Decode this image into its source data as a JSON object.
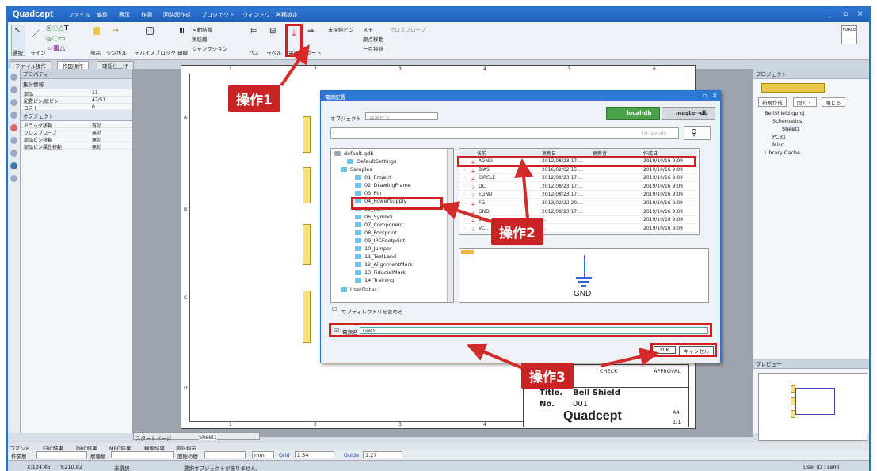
{
  "app": {
    "logo": "Quadcept",
    "menus": [
      "ファイル",
      "編集",
      "表示",
      "作図",
      "回路図作成",
      "プロジェクト",
      "ウィンドウ",
      "各種設定"
    ],
    "win_min": "_",
    "win_max": "▫",
    "win_close": "×"
  },
  "ribbon": {
    "select": "選択",
    "line": "ライン",
    "part": "部品",
    "symbol": "シンボル",
    "device_block": "デバイスブロック",
    "bus_entry": "母線",
    "auto_wire": "自動結線",
    "real_wire": "実結線",
    "junction": "ジャンクション",
    "path": "パス",
    "label": "ラベル",
    "power": "電源",
    "port": "ポート",
    "unconnected": "未接続ピン",
    "memo": "メモ",
    "cross_probe": "クロスプローブ",
    "origin_move": "原点移動",
    "one_move": "一点接続",
    "force": "FORCE"
  },
  "tabs": [
    "ファイル操作",
    "作図操作",
    "確認仕上げ"
  ],
  "props": {
    "title": "プロパティ",
    "section1": "集計情報",
    "rows1": [
      {
        "k": "部品",
        "v": "11"
      },
      {
        "k": "配置ピン/総ピン",
        "v": "47/51"
      },
      {
        "k": "コスト",
        "v": "0"
      }
    ],
    "section2": "オブジェクト",
    "rows2": [
      {
        "k": "ドラッグ移動",
        "v": "有効"
      },
      {
        "k": "クロスプローブ",
        "v": "無効"
      },
      {
        "k": "部品ピン移動",
        "v": "無効"
      },
      {
        "k": "部品ピン属性移動",
        "v": "無効"
      }
    ]
  },
  "sheet": {
    "cols": [
      "1",
      "2",
      "3",
      "4",
      "5",
      "6"
    ],
    "rows": [
      "A",
      "B",
      "C",
      "D"
    ],
    "titleblock": {
      "check": "CHECK",
      "approval": "APPROVAL",
      "title_label": "Title.",
      "title": "Bell Shield",
      "no_label": "No.",
      "no": "001",
      "brand": "Quadcept",
      "size": "A4",
      "page": "1/1"
    }
  },
  "dialog": {
    "title": "電源配置",
    "object_label": "オブジェクト",
    "object_value": "電源ピン",
    "local_db": "local-db",
    "master_db": "master-db",
    "results": "10 results",
    "tree": [
      "default.qdb",
      "DefaultSettings",
      "Samples",
      "01_Project",
      "02_DrawingFrame",
      "03_Pin",
      "04_PowerSupply",
      "05_Port",
      "06_Symbol",
      "07_Component",
      "08_Footprint",
      "09_IPCFootprint",
      "10_Jumper",
      "11_TestLand",
      "12_AlignmentMark",
      "13_FiducialMark",
      "14_Training",
      "UserDatas"
    ],
    "subdir": "サブディレクトリを含める",
    "headers": [
      "名前",
      "更新日",
      "更新者",
      "作成日"
    ],
    "rows": [
      {
        "name": "AGND",
        "upd": "2012/08/23 17:…",
        "cr": "2019/10/16 9:09"
      },
      {
        "name": "BIAS",
        "upd": "2016/02/02 15:…",
        "cr": "2019/10/16 9:09"
      },
      {
        "name": "CIRCLE",
        "upd": "2012/08/23 17:…",
        "cr": "2019/10/16 9:09"
      },
      {
        "name": "DC",
        "upd": "2012/08/23 17:…",
        "cr": "2019/10/16 9:09"
      },
      {
        "name": "EGND",
        "upd": "2012/08/23 17:…",
        "cr": "2019/10/16 9:09"
      },
      {
        "name": "FG",
        "upd": "2013/02/22 20:…",
        "cr": "2019/10/16 9:09"
      },
      {
        "name": "GND",
        "upd": "2012/08/23 17:…",
        "cr": "2019/10/16 9:09"
      },
      {
        "name": "V…",
        "upd": "…",
        "cr": "2019/10/16 9:09"
      },
      {
        "name": "VC…",
        "upd": "…",
        "cr": "2019/10/16 9:09"
      }
    ],
    "preview_label": "GND",
    "name_label": "電源名",
    "name_value": "GND",
    "ok": "O K",
    "cancel": "キャンセル"
  },
  "callouts": {
    "op1": "操作1",
    "op2": "操作2",
    "op3": "操作3"
  },
  "project": {
    "title": "プロジェクト",
    "new_btn": "新規作成",
    "open_btn": "開く・",
    "close_btn": "閉じる",
    "tree": [
      "BellShield.qproj",
      "Schematics",
      "Sheet1",
      "PCB1",
      "Misc",
      "Library Cache"
    ],
    "preview_title": "プレビュー"
  },
  "doc_tabs": {
    "start": "スタートページ",
    "sheet": "Sheet1"
  },
  "bottom": {
    "tabs": [
      "コマンド",
      "ERC結果",
      "DRC結果",
      "MRC結果",
      "検索結果",
      "設計指示"
    ],
    "layer_label": "作業層",
    "type_label": "層種類",
    "face_label": "面総の層",
    "unit": "mm",
    "grid_label": "Grid",
    "grid_value": "2.54",
    "guide_label": "Guide",
    "guide_value": "1.27"
  },
  "status": {
    "x": "X:124.46",
    "y": "Y:210.82",
    "sel": "未選択",
    "msg": "選択オブジェクトがありません。",
    "user": "User ID : semi"
  }
}
